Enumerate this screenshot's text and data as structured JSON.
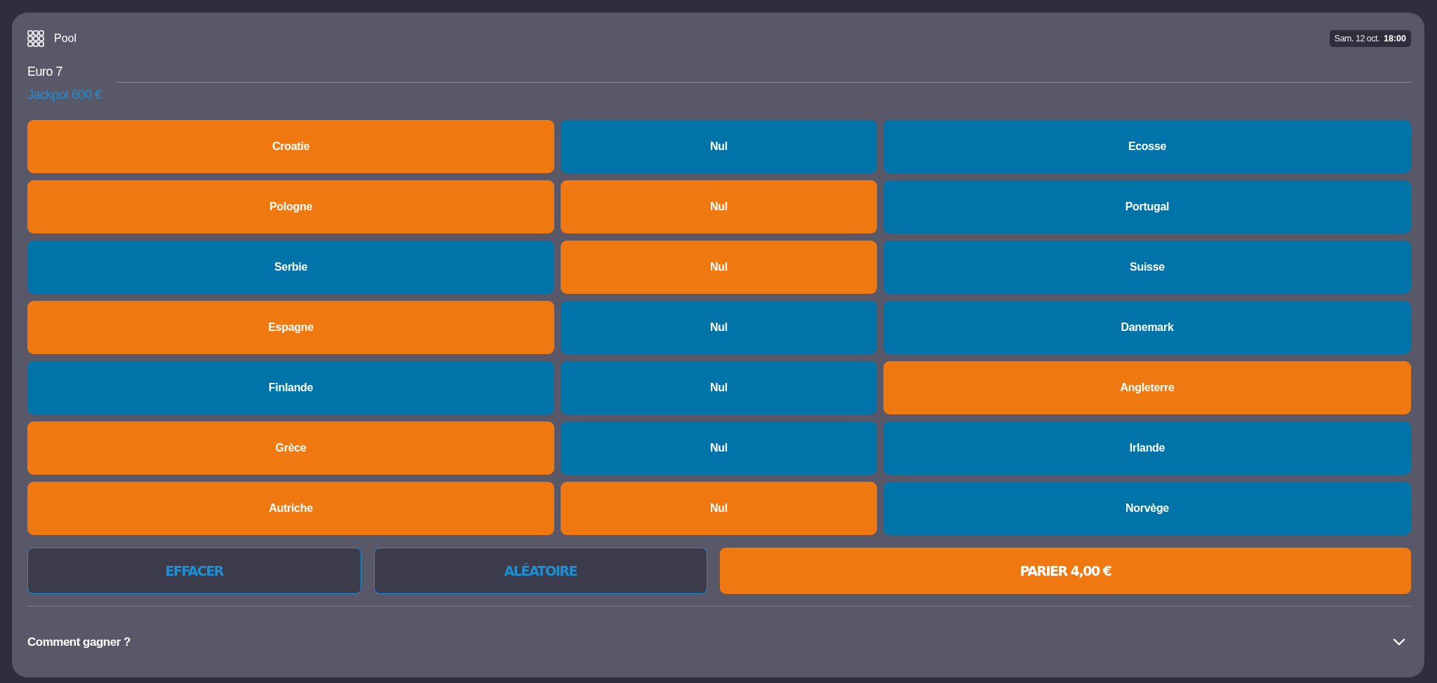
{
  "header": {
    "title": "Pool",
    "date": "Sam. 12 oct.",
    "time": "18:00"
  },
  "game": {
    "name": "Euro 7",
    "jackpot": "Jackpot 600 €"
  },
  "matches": [
    {
      "options": [
        {
          "label": "Croatie",
          "selected": true
        },
        {
          "label": "Nul",
          "selected": false
        },
        {
          "label": "Ecosse",
          "selected": false
        }
      ]
    },
    {
      "options": [
        {
          "label": "Pologne",
          "selected": true
        },
        {
          "label": "Nul",
          "selected": true
        },
        {
          "label": "Portugal",
          "selected": false
        }
      ]
    },
    {
      "options": [
        {
          "label": "Serbie",
          "selected": false
        },
        {
          "label": "Nul",
          "selected": true
        },
        {
          "label": "Suisse",
          "selected": false
        }
      ]
    },
    {
      "options": [
        {
          "label": "Espagne",
          "selected": true
        },
        {
          "label": "Nul",
          "selected": false
        },
        {
          "label": "Danemark",
          "selected": false
        }
      ]
    },
    {
      "options": [
        {
          "label": "Finlande",
          "selected": false
        },
        {
          "label": "Nul",
          "selected": false
        },
        {
          "label": "Angleterre",
          "selected": true
        }
      ]
    },
    {
      "options": [
        {
          "label": "Grèce",
          "selected": true
        },
        {
          "label": "Nul",
          "selected": false
        },
        {
          "label": "Irlande",
          "selected": false
        }
      ]
    },
    {
      "options": [
        {
          "label": "Autriche",
          "selected": true
        },
        {
          "label": "Nul",
          "selected": true
        },
        {
          "label": "Norvège",
          "selected": false
        }
      ]
    }
  ],
  "actions": [
    {
      "label": "EFFACER",
      "kind": "outline"
    },
    {
      "label": "ALÉATOIRE",
      "kind": "outline"
    },
    {
      "label": "PARIER 4,00 €",
      "kind": "primary"
    }
  ],
  "accordion": {
    "label": "Comment gagner ?",
    "expanded": false
  }
}
